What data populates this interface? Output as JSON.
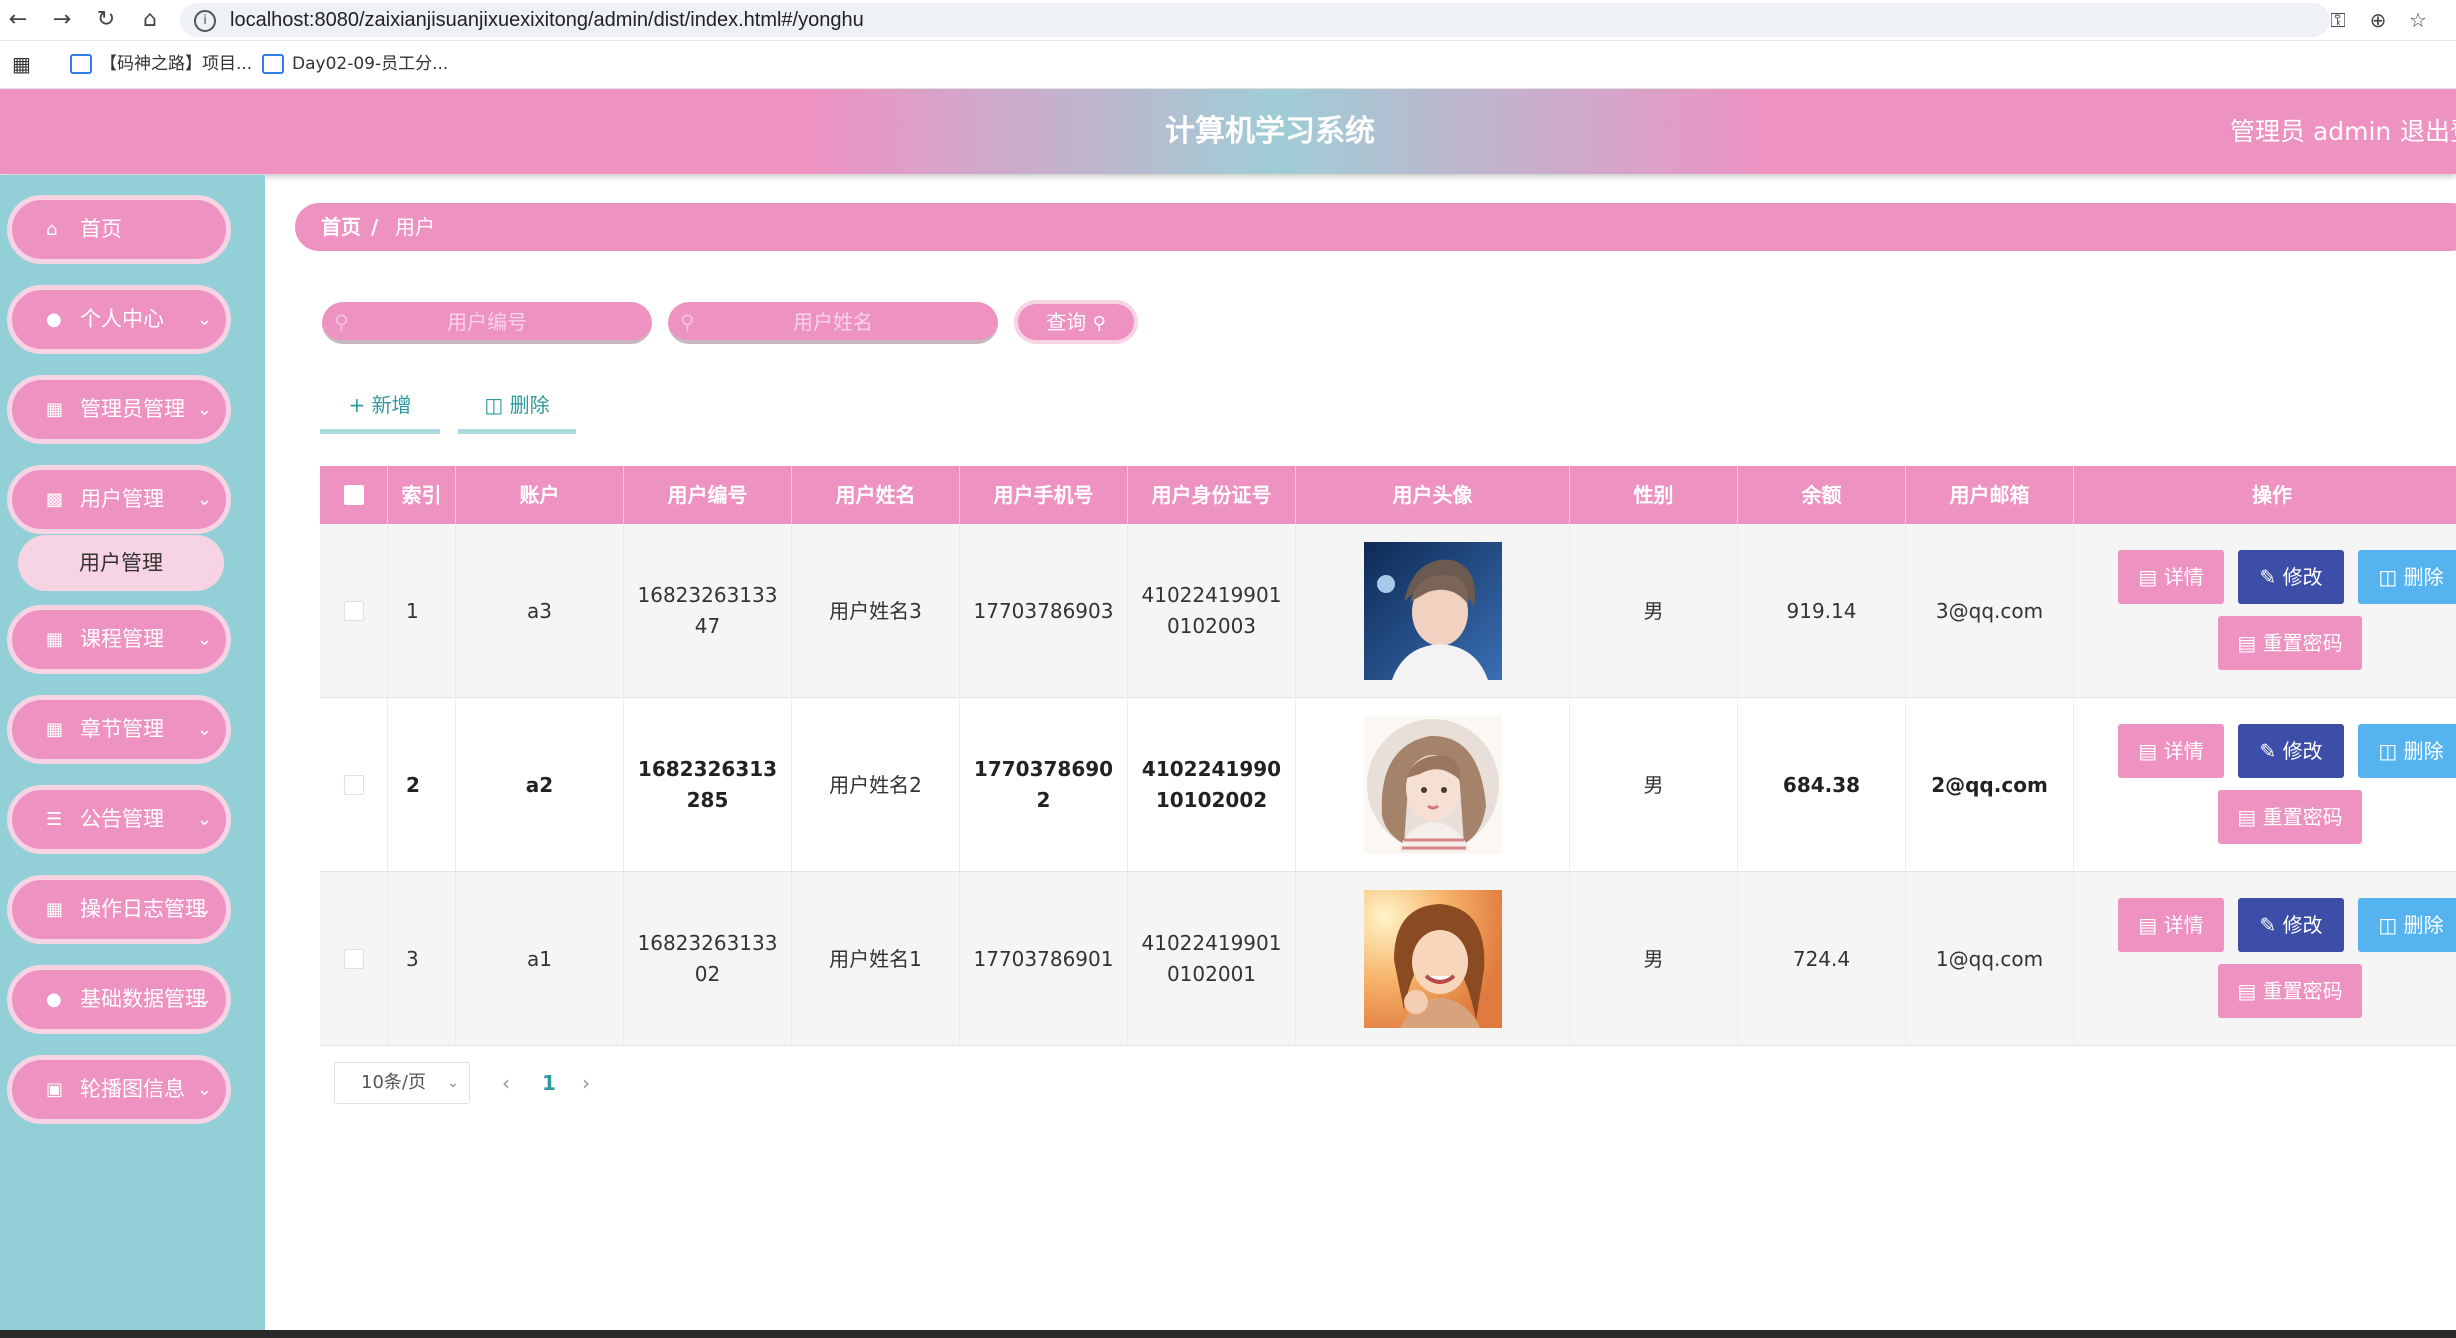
{
  "browser": {
    "url": "localhost:8080/zaixianjisuanjixuexixitong/admin/dist/index.html#/yonghu",
    "bookmarks": [
      {
        "label": "【码神之路】项目..."
      },
      {
        "label": "Day02-09-员工分..."
      }
    ]
  },
  "header": {
    "title": "计算机学习系统",
    "admin_label": "管理员 admin",
    "logout_label": "退出登"
  },
  "sidebar": {
    "items": [
      {
        "label": "首页",
        "icon": "home-icon",
        "has_arrow": false
      },
      {
        "label": "个人中心",
        "icon": "user-icon",
        "has_arrow": true
      },
      {
        "label": "管理员管理",
        "icon": "grid-icon",
        "has_arrow": true
      },
      {
        "label": "用户管理",
        "icon": "ticket-icon",
        "has_arrow": true
      },
      {
        "label": "课程管理",
        "icon": "grid-icon",
        "has_arrow": true
      },
      {
        "label": "章节管理",
        "icon": "grid-icon",
        "has_arrow": true
      },
      {
        "label": "公告管理",
        "icon": "list-icon",
        "has_arrow": true
      },
      {
        "label": "操作日志管理",
        "icon": "grid-icon",
        "has_arrow": true
      },
      {
        "label": "基础数据管理",
        "icon": "user-icon",
        "has_arrow": true
      },
      {
        "label": "轮播图信息",
        "icon": "clipboard-icon",
        "has_arrow": true
      }
    ],
    "sub_item": "用户管理"
  },
  "breadcrumb": {
    "home": "首页",
    "separator": "/",
    "current": "用户"
  },
  "search": {
    "user_number_placeholder": "用户编号",
    "user_name_placeholder": "用户姓名",
    "query_label": "查询"
  },
  "actions": {
    "add_label": "新增",
    "delete_label": "删除"
  },
  "table": {
    "columns": [
      "索引",
      "账户",
      "用户编号",
      "用户姓名",
      "用户手机号",
      "用户身份证号",
      "用户头像",
      "性别",
      "余额",
      "用户邮箱",
      "操作"
    ],
    "rows": [
      {
        "index": "1",
        "account": "a3",
        "number": "1682326313347",
        "name": "用户姓名3",
        "phone": "17703786903",
        "id_card": "410224199010102003",
        "avatar": "avatar-male-photo",
        "gender": "男",
        "balance": "919.14",
        "email": "3@qq.com"
      },
      {
        "index": "2",
        "account": "a2",
        "number": "1682326313285",
        "name": "用户姓名2",
        "phone": "17703786902",
        "id_card": "410224199010102002",
        "avatar": "avatar-female-illustration",
        "gender": "男",
        "balance": "684.38",
        "email": "2@qq.com"
      },
      {
        "index": "3",
        "account": "a1",
        "number": "1682326313302",
        "name": "用户姓名1",
        "phone": "17703786901",
        "id_card": "410224199010102001",
        "avatar": "avatar-female-photo",
        "gender": "男",
        "balance": "724.4",
        "email": "1@qq.com"
      }
    ],
    "row_actions": {
      "detail": "详情",
      "edit": "修改",
      "delete": "删除",
      "reset": "重置密码"
    }
  },
  "pagination": {
    "page_size": "10条/页",
    "current_page": "1"
  },
  "colors": {
    "pink": "#ee92c2",
    "teal": "#92cfd6",
    "edit_blue": "#3d4ea8",
    "delete_blue": "#55b3f0"
  }
}
